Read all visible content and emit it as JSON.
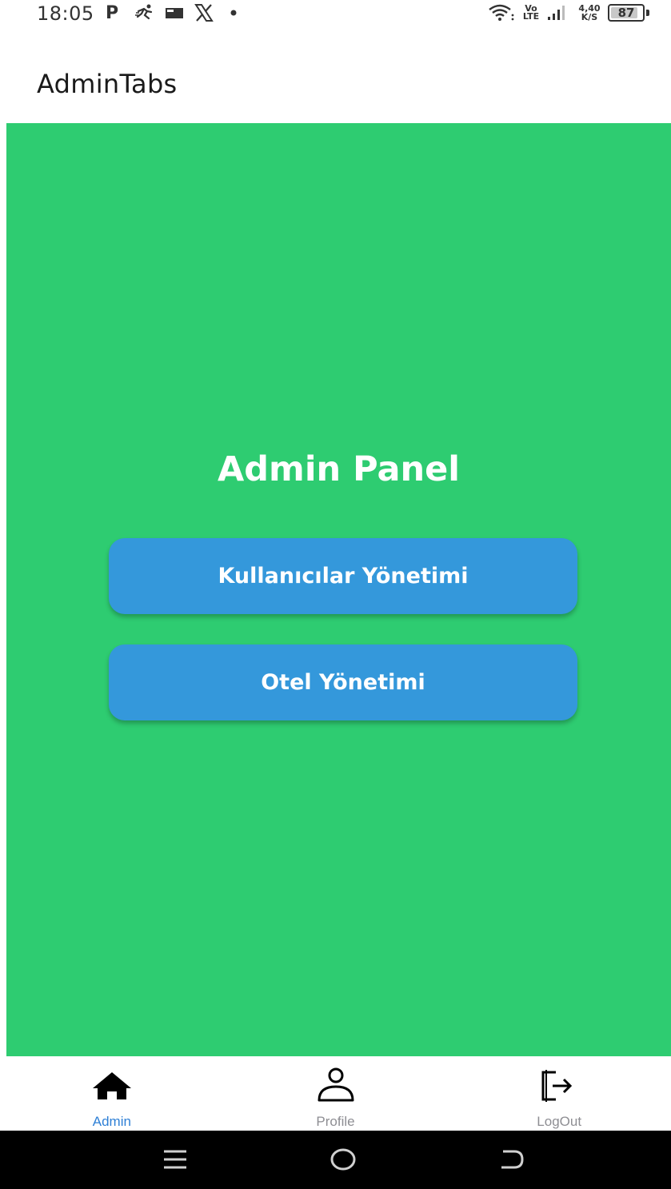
{
  "status_bar": {
    "time": "18:05",
    "p_icon": "P",
    "volte_top": "Vo",
    "volte_bottom": "LTE",
    "speed_value": "4,40",
    "speed_unit": "K/S",
    "battery_level": "87",
    "icons": [
      "p-icon",
      "running-icon",
      "message-icon",
      "x-logo-icon",
      "dot-icon",
      "wifi-icon",
      "volte-icon",
      "signal-icon",
      "speed-indicator",
      "battery-icon"
    ]
  },
  "header": {
    "title": "AdminTabs"
  },
  "main": {
    "title": "Admin Panel",
    "background_color": "#2ecc71",
    "buttons": [
      {
        "label": "Kullanıcılar Yönetimi",
        "color": "#3498db"
      },
      {
        "label": "Otel Yönetimi",
        "color": "#3498db"
      }
    ]
  },
  "tabs": [
    {
      "label": "Admin",
      "icon": "home-icon",
      "active": true
    },
    {
      "label": "Profile",
      "icon": "person-icon",
      "active": false
    },
    {
      "label": "LogOut",
      "icon": "logout-icon",
      "active": false
    }
  ],
  "colors": {
    "active_tab": "#2f80d6",
    "inactive_tab": "#8e8e93"
  },
  "nav_bar": {
    "icons": [
      "recent-apps-icon",
      "home-circle-icon",
      "back-icon"
    ]
  }
}
